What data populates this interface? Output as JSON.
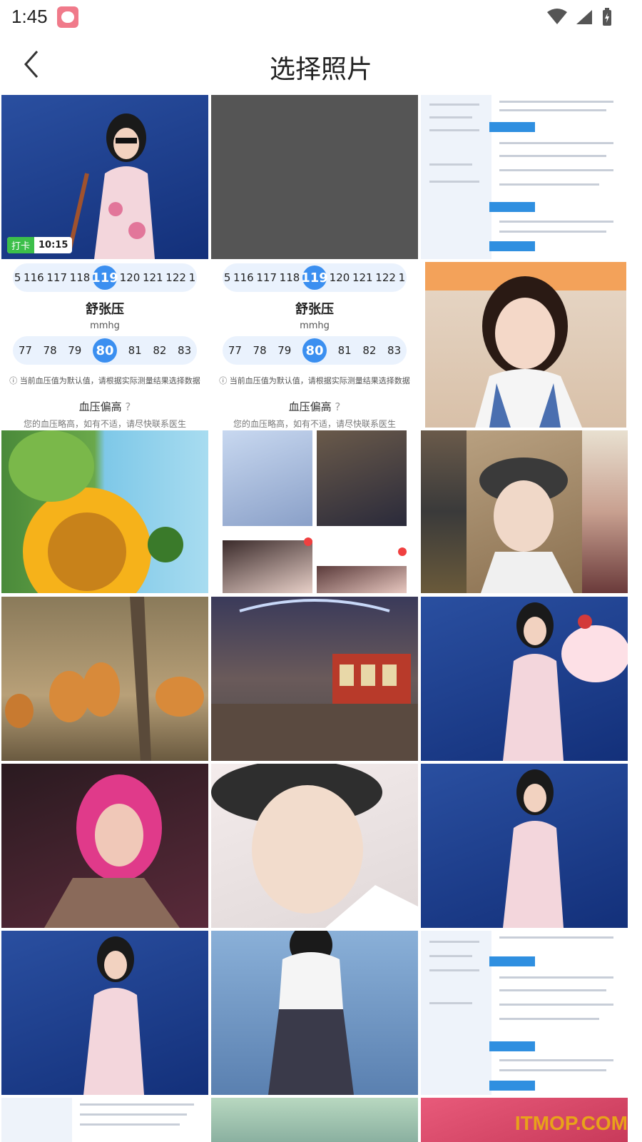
{
  "status": {
    "time": "1:45"
  },
  "header": {
    "title": "选择照片"
  },
  "bp_widget": {
    "systolic_ticks": [
      "5",
      "116",
      "117",
      "118",
      "119",
      "120",
      "121",
      "122",
      "1"
    ],
    "diastolic_ticks": [
      "77",
      "78",
      "79",
      "80",
      "81",
      "82",
      "83"
    ],
    "diastolic_title": "舒张压",
    "unit": "mmhg",
    "note": "当前血压值为默认值，请根据实际测量结果选择数据",
    "status": "血压偏高",
    "advice": "您的血压略高，如有不适，请尽快联系医生"
  },
  "photo_badge": {
    "label": "打卡",
    "time": "10:15"
  },
  "watermark": "ITMOP.COM",
  "colors": {
    "accent": "#3b8ff0",
    "sea": "#1f3f8f",
    "resume_accent": "#2f8fe0"
  },
  "icons": [
    "back-arrow-icon",
    "wifi-icon",
    "signal-icon",
    "battery-icon",
    "info-icon",
    "help-icon"
  ]
}
